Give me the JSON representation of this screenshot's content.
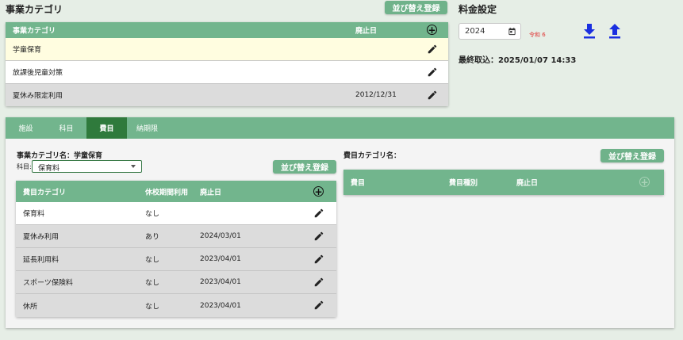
{
  "business_category": {
    "title": "事業カテゴリ",
    "reorder_button": "並び替え登録",
    "table": {
      "col_name": "事業カテゴリ",
      "col_abolish": "廃止日",
      "rows": [
        {
          "name": "学童保育",
          "abolish": ""
        },
        {
          "name": "放課後児童対策",
          "abolish": ""
        },
        {
          "name": "夏休み限定利用",
          "abolish": "2012/12/31"
        }
      ]
    }
  },
  "fee_settings": {
    "title": "料金設定",
    "year_value": "2024",
    "era_label": "令和 6",
    "last_import": "最終取込：2025/01/07 14:33"
  },
  "tabs": [
    "施設",
    "科目",
    "費目",
    "納期限"
  ],
  "active_tab": "費目",
  "fee_panel": {
    "category_label": "事業カテゴリ名：学童保育",
    "subject_label": "科目:",
    "subject_value": "保育料",
    "reorder_button": "並び替え登録",
    "table": {
      "col_category": "費目カテゴリ",
      "col_closure": "休校期間利用",
      "col_abolish": "廃止日",
      "rows": [
        {
          "category": "保育料",
          "closure": "なし",
          "abolish": ""
        },
        {
          "category": "夏休み利用",
          "closure": "あり",
          "abolish": "2024/03/01"
        },
        {
          "category": "延長利用料",
          "closure": "なし",
          "abolish": "2023/04/01"
        },
        {
          "category": "スポーツ保険料",
          "closure": "なし",
          "abolish": "2023/04/01"
        },
        {
          "category": "休所",
          "closure": "なし",
          "abolish": "2023/04/01"
        }
      ]
    }
  },
  "fee_item_panel": {
    "label": "費目カテゴリ名：",
    "reorder_button": "並び替え登録",
    "table": {
      "col_item": "費目",
      "col_type": "費目種別",
      "col_abolish": "廃止日"
    }
  },
  "colors": {
    "header_green": "#72b58d",
    "active_tab": "#2f7a3c",
    "selected_row": "#fffde0",
    "accent_blue": "#1a2fe0",
    "era_red": "#e03030"
  }
}
